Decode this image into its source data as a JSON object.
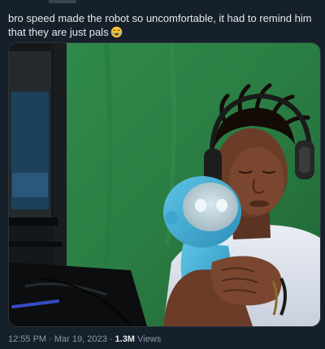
{
  "tweet": {
    "text": "bro speed made the robot so uncomfortable, it had to remind him that they are just pals",
    "emoji": "crying-face-emoji"
  },
  "media": {
    "type": "video-still",
    "description_icon": "video-frame"
  },
  "meta": {
    "time": "12:55 PM",
    "separator": "·",
    "date": "Mar 19, 2023",
    "views_count": "1.3M",
    "views_label": "Views"
  }
}
